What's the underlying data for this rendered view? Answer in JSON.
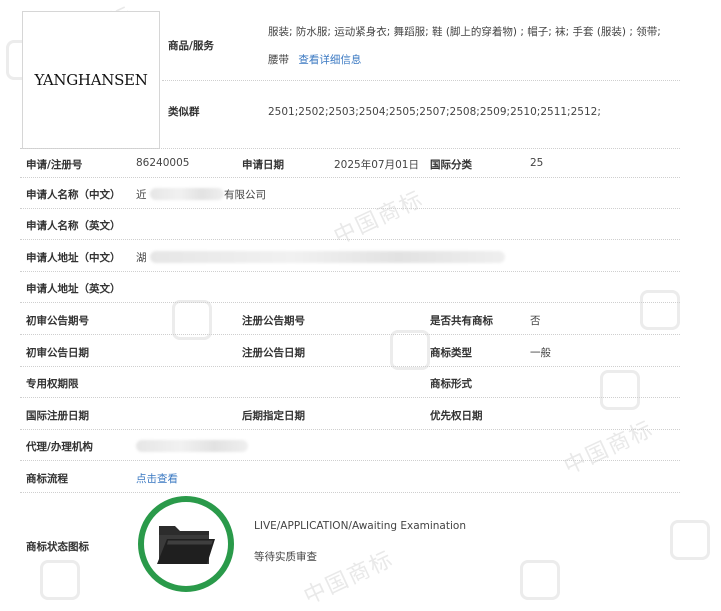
{
  "logo": {
    "text": "YANGHANSEN"
  },
  "goods": {
    "label": "商品/服务",
    "line1": "服装; 防水服; 运动紧身衣; 舞蹈服; 鞋 (脚上的穿着物) ; 帽子; 袜; 手套 (服装) ; 领带;",
    "line2": "腰带",
    "link": "查看详细信息"
  },
  "similar_group": {
    "label": "类似群",
    "value": "2501;2502;2503;2504;2505;2507;2508;2509;2510;2511;2512;"
  },
  "reg_no": {
    "label": "申请/注册号",
    "value": "86240005"
  },
  "app_date": {
    "label": "申请日期",
    "value": "2025年07月01日"
  },
  "intl_class": {
    "label": "国际分类",
    "value": "25"
  },
  "applicant_cn": {
    "label": "申请人名称（中文）",
    "value_prefix": "近",
    "value_suffix": "有限公司"
  },
  "applicant_en": {
    "label": "申请人名称（英文）"
  },
  "address_cn": {
    "label": "申请人地址（中文）",
    "value_prefix": "湖"
  },
  "address_en": {
    "label": "申请人地址（英文）"
  },
  "prelim_no": {
    "label": "初审公告期号"
  },
  "reg_pub_no": {
    "label": "注册公告期号"
  },
  "shared": {
    "label": "是否共有商标",
    "value": "否"
  },
  "prelim_date": {
    "label": "初审公告日期"
  },
  "reg_pub_date": {
    "label": "注册公告日期"
  },
  "mark_type": {
    "label": "商标类型",
    "value": "一般"
  },
  "exclusive": {
    "label": "专用权期限"
  },
  "mark_form": {
    "label": "商标形式"
  },
  "intl_reg_date": {
    "label": "国际注册日期"
  },
  "later_date": {
    "label": "后期指定日期"
  },
  "priority_date": {
    "label": "优先权日期"
  },
  "agent": {
    "label": "代理/办理机构"
  },
  "process": {
    "label": "商标流程",
    "link": "点击查看"
  },
  "status": {
    "label": "商标状态图标",
    "en": "LIVE/APPLICATION/Awaiting Examination",
    "cn": "等待实质审查",
    "ring_color": "#2a9a4a"
  },
  "watermark": {
    "text": "中国商标"
  }
}
